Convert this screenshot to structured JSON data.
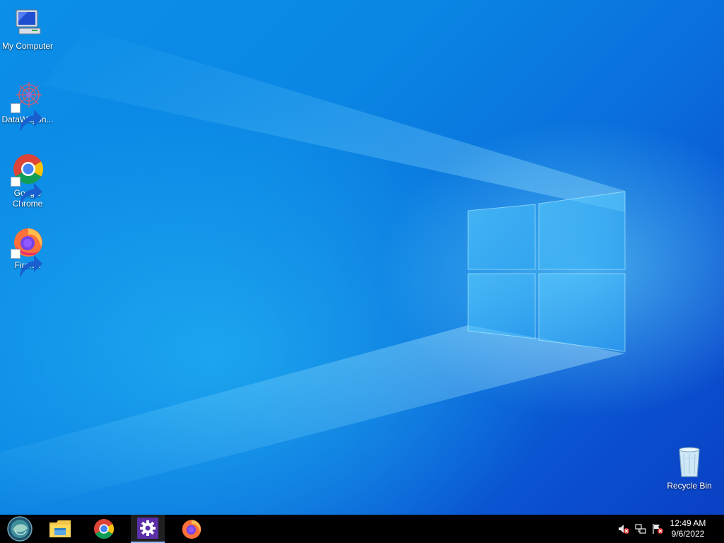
{
  "desktop": {
    "icons": [
      {
        "label": "My Computer",
        "icon": "my-computer-icon"
      },
      {
        "label": "DataWagon...",
        "icon": "datawagon-icon"
      },
      {
        "label": "Google\nChrome",
        "icon": "chrome-icon"
      },
      {
        "label": "Firefox",
        "icon": "firefox-icon"
      },
      {
        "label": "Recycle Bin",
        "icon": "recycle-bin-icon"
      }
    ],
    "accent_color": "#0a86e4"
  },
  "taskbar": {
    "pinned": [
      {
        "icon": "start-orb-icon"
      },
      {
        "icon": "file-explorer-icon"
      },
      {
        "icon": "chrome-icon"
      },
      {
        "icon": "settings-gear-icon"
      },
      {
        "icon": "firefox-icon"
      }
    ],
    "tray": [
      {
        "icon": "volume-muted-icon"
      },
      {
        "icon": "network-icon"
      },
      {
        "icon": "action-center-flag-icon"
      }
    ],
    "clock": {
      "time": "12:49 AM",
      "date": "9/6/2022"
    }
  }
}
